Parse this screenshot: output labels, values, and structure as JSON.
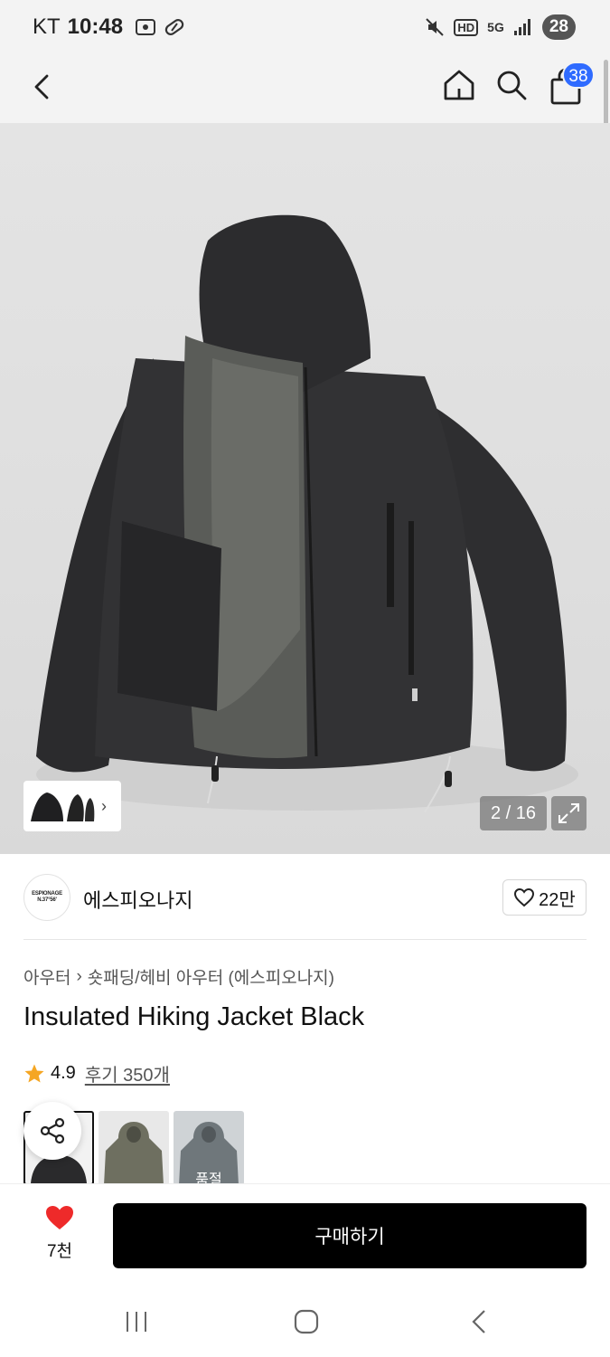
{
  "status_bar": {
    "carrier": "KT",
    "time": "10:48",
    "network": "5G",
    "quality": "HD",
    "battery": "28"
  },
  "nav": {
    "cart_count": "38"
  },
  "gallery": {
    "counter": "2 / 16"
  },
  "brand": {
    "logo_line1": "ESPIONAGE",
    "logo_line2": "N.37°56'",
    "name": "에스피오나지",
    "like_count": "22만"
  },
  "product": {
    "breadcrumb": [
      "아우터",
      "숏패딩/헤비 아우터 (에스피오나지)"
    ],
    "title": "Insulated Hiking Jacket Black",
    "rating": "4.9",
    "reviews": "후기 350개",
    "variants": [
      {
        "color": "#2a2a2c",
        "sold_out": ""
      },
      {
        "color": "#6e6f60",
        "sold_out": ""
      },
      {
        "color": "#6f777b",
        "sold_out": "품절"
      }
    ]
  },
  "bottom": {
    "wish_count": "7천",
    "buy_label": "구매하기"
  },
  "colors": {
    "accent": "#2f6bff",
    "heart": "#ee2a2a",
    "star": "#f5a623"
  }
}
